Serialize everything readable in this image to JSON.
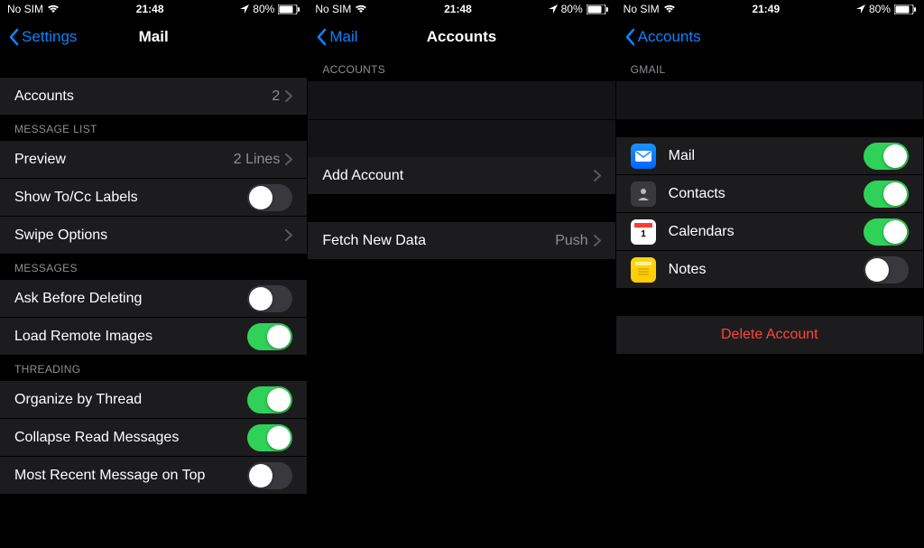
{
  "screens": [
    {
      "status": {
        "left": "No SIM",
        "time": "21:48",
        "battery": "80%"
      },
      "nav": {
        "back": "Settings",
        "title": "Mail"
      },
      "groups": [
        {
          "header": null,
          "rows": [
            {
              "label": "Accounts",
              "value": "2",
              "type": "disclosure"
            }
          ]
        },
        {
          "header": "MESSAGE LIST",
          "rows": [
            {
              "label": "Preview",
              "value": "2 Lines",
              "type": "disclosure"
            },
            {
              "label": "Show To/Cc Labels",
              "type": "toggle",
              "on": false
            },
            {
              "label": "Swipe Options",
              "type": "disclosure"
            }
          ]
        },
        {
          "header": "MESSAGES",
          "rows": [
            {
              "label": "Ask Before Deleting",
              "type": "toggle",
              "on": false
            },
            {
              "label": "Load Remote Images",
              "type": "toggle",
              "on": true
            }
          ]
        },
        {
          "header": "THREADING",
          "rows": [
            {
              "label": "Organize by Thread",
              "type": "toggle",
              "on": true
            },
            {
              "label": "Collapse Read Messages",
              "type": "toggle",
              "on": true
            },
            {
              "label": "Most Recent Message on Top",
              "type": "toggle",
              "on": false
            }
          ]
        }
      ]
    },
    {
      "status": {
        "left": "No SIM",
        "time": "21:48",
        "battery": "80%"
      },
      "nav": {
        "back": "Mail",
        "title": "Accounts"
      },
      "groups": [
        {
          "header": "ACCOUNTS",
          "rows": [
            {
              "type": "redacted"
            },
            {
              "type": "redacted"
            },
            {
              "label": "Add Account",
              "type": "disclosure"
            }
          ]
        },
        {
          "header": null,
          "rows": [
            {
              "label": "Fetch New Data",
              "value": "Push",
              "type": "disclosure"
            }
          ]
        }
      ]
    },
    {
      "status": {
        "left": "No SIM",
        "time": "21:49",
        "battery": "80%"
      },
      "nav": {
        "back": "Accounts",
        "title": ""
      },
      "groups": [
        {
          "header": "GMAIL",
          "rows": [
            {
              "type": "redacted"
            }
          ]
        },
        {
          "header": null,
          "rows": [
            {
              "label": "Mail",
              "type": "toggle-icon",
              "icon": "mail",
              "on": true
            },
            {
              "label": "Contacts",
              "type": "toggle-icon",
              "icon": "contacts",
              "on": true
            },
            {
              "label": "Calendars",
              "type": "toggle-icon",
              "icon": "calendar",
              "on": true
            },
            {
              "label": "Notes",
              "type": "toggle-icon",
              "icon": "notes",
              "on": false
            }
          ]
        },
        {
          "header": null,
          "rows": [
            {
              "label": "Delete Account",
              "type": "delete"
            }
          ]
        }
      ]
    }
  ]
}
